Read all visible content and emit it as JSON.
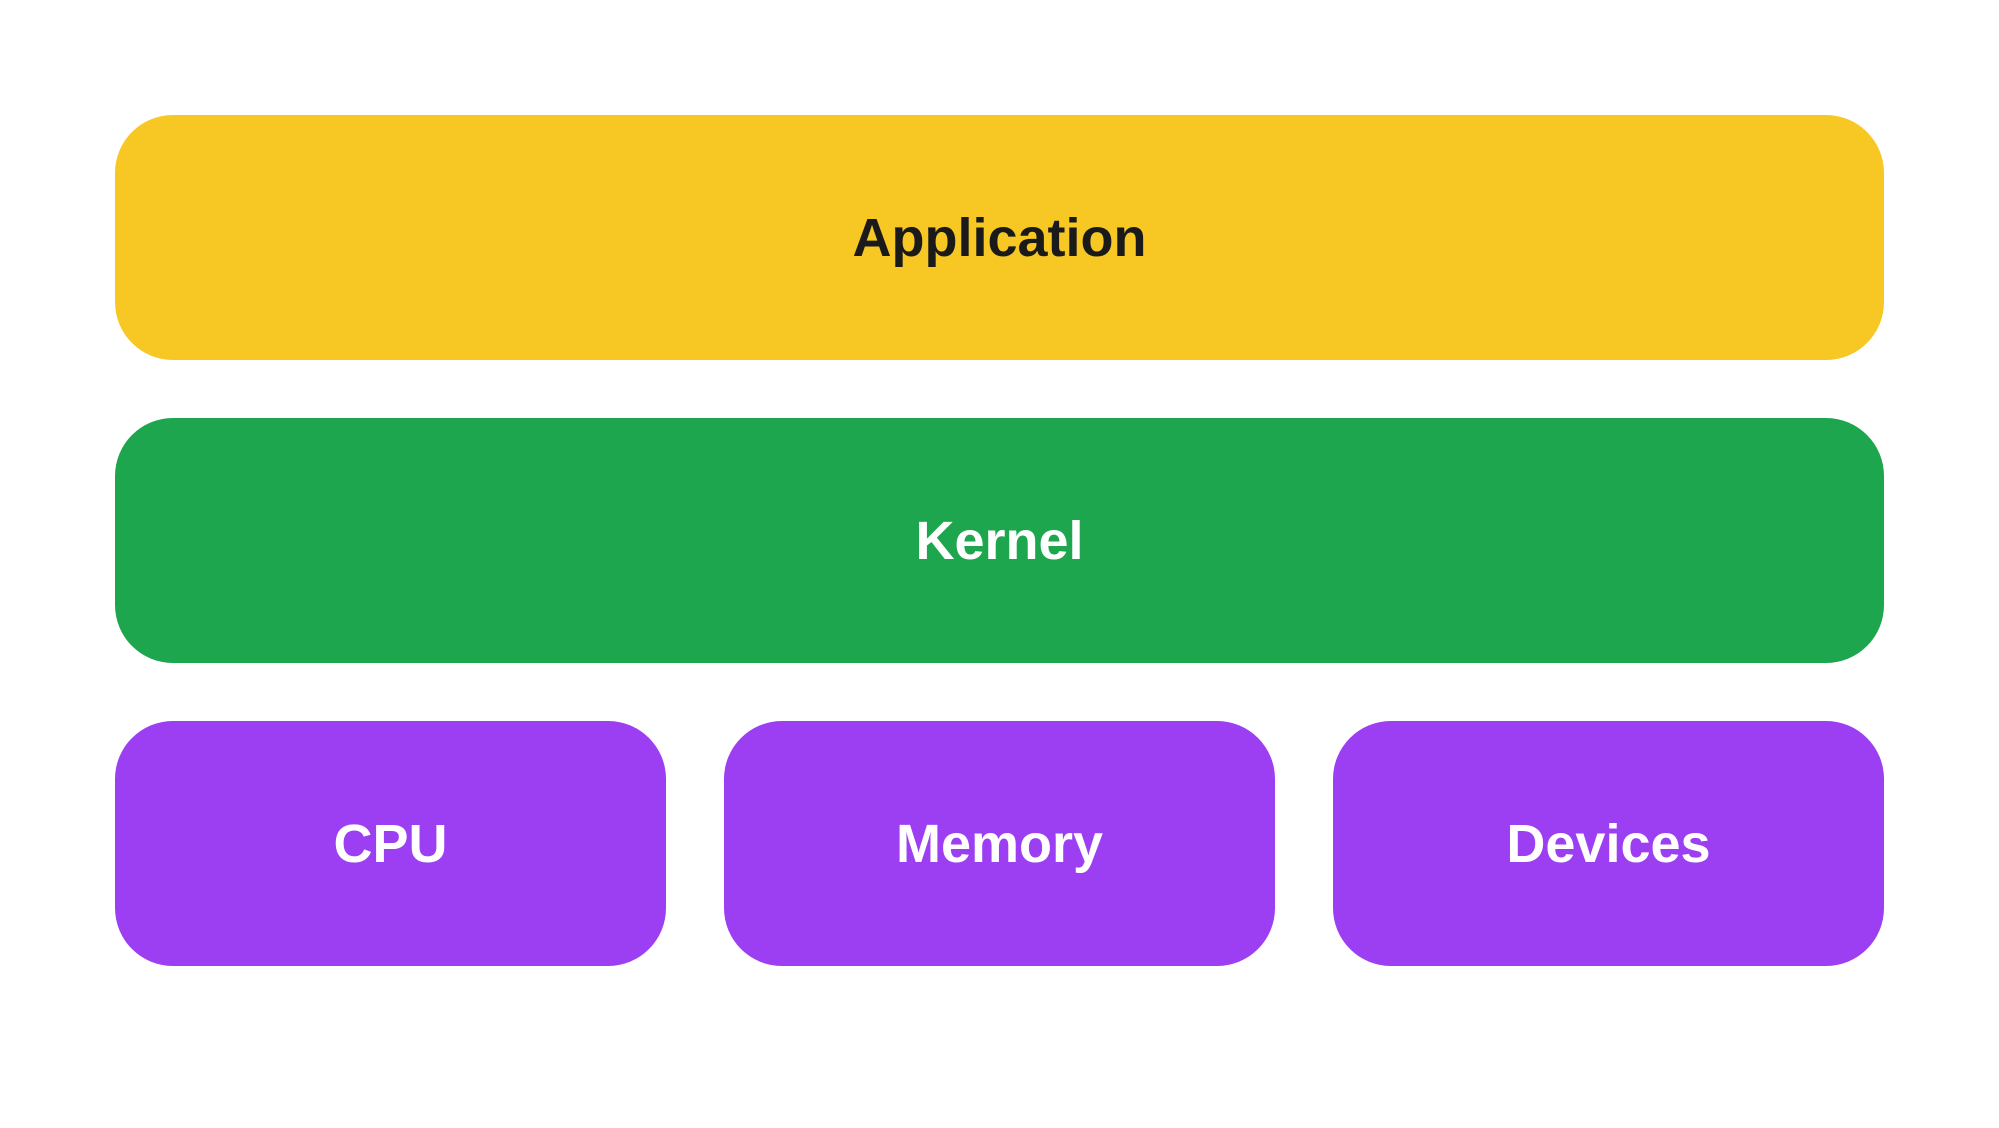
{
  "layers": {
    "application": {
      "label": "Application",
      "color": "#f7c824",
      "text_color": "#1a1a1a"
    },
    "kernel": {
      "label": "Kernel",
      "color": "#1ea64e",
      "text_color": "#ffffff"
    },
    "hardware": {
      "color": "#9c3ef2",
      "text_color": "#ffffff",
      "items": [
        {
          "label": "CPU"
        },
        {
          "label": "Memory"
        },
        {
          "label": "Devices"
        }
      ]
    }
  }
}
